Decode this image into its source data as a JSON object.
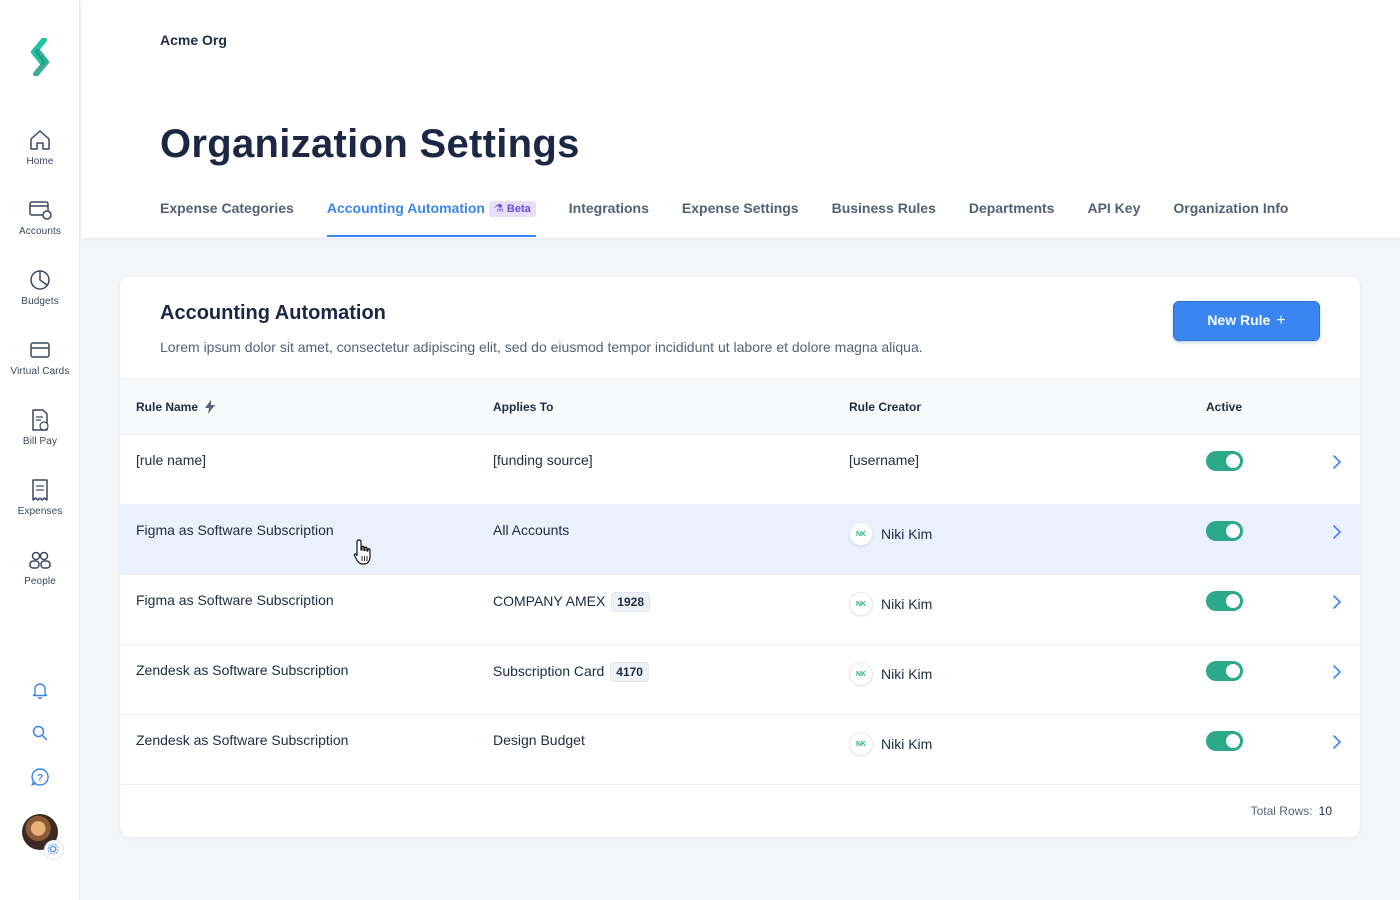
{
  "sidebar": {
    "items": [
      {
        "label": "Home",
        "icon": "home-icon"
      },
      {
        "label": "Accounts",
        "icon": "accounts-icon"
      },
      {
        "label": "Budgets",
        "icon": "budgets-icon"
      },
      {
        "label": "Virtual Cards",
        "icon": "virtual-card-icon"
      },
      {
        "label": "Bill Pay",
        "icon": "bill-pay-icon"
      },
      {
        "label": "Expenses",
        "icon": "receipt-icon"
      },
      {
        "label": "People",
        "icon": "people-icon"
      }
    ],
    "utilities": [
      "bell-icon",
      "search-icon",
      "help-icon"
    ]
  },
  "header": {
    "org_name": "Acme Org",
    "title": "Organization Settings",
    "tabs": [
      {
        "label": "Expense Categories",
        "active": false
      },
      {
        "label": "Accounting Automation",
        "active": true,
        "badge": "Beta"
      },
      {
        "label": "Integrations",
        "active": false
      },
      {
        "label": "Expense Settings",
        "active": false
      },
      {
        "label": "Business Rules",
        "active": false
      },
      {
        "label": "Departments",
        "active": false
      },
      {
        "label": "API Key",
        "active": false
      },
      {
        "label": "Organization Info",
        "active": false
      }
    ]
  },
  "card": {
    "title": "Accounting Automation",
    "description": "Lorem ipsum dolor sit amet, consectetur adipiscing elit, sed do eiusmod tempor incididunt ut labore et dolore magna aliqua.",
    "new_rule_label": "New Rule",
    "new_rule_icon": "+"
  },
  "table": {
    "columns": {
      "rule_name": "Rule Name",
      "applies_to": "Applies To",
      "rule_creator": "Rule Creator",
      "active": "Active"
    },
    "rows": [
      {
        "rule_name": "[rule name]",
        "applies_to": "[funding source]",
        "chip": "",
        "creator": "[username]",
        "initials": "",
        "active": true
      },
      {
        "rule_name": "Figma as Software Subscription",
        "applies_to": "All Accounts",
        "chip": "",
        "creator": "Niki Kim",
        "initials": "NK",
        "active": true
      },
      {
        "rule_name": "Figma as Software Subscription",
        "applies_to": "COMPANY AMEX",
        "chip": "1928",
        "creator": "Niki Kim",
        "initials": "NK",
        "active": true
      },
      {
        "rule_name": "Zendesk as Software Subscription",
        "applies_to": "Subscription Card",
        "chip": "4170",
        "creator": "Niki Kim",
        "initials": "NK",
        "active": true
      },
      {
        "rule_name": "Zendesk as Software Subscription",
        "applies_to": "Design Budget",
        "chip": "",
        "creator": "Niki Kim",
        "initials": "NK",
        "active": true
      }
    ],
    "total_rows_label": "Total Rows:",
    "total_rows_value": "10"
  },
  "colors": {
    "accent": "#3a86f0",
    "toggle_on": "#2ba98a",
    "logo_green": "#2bb08a",
    "hover_row": "#eaf1fc"
  }
}
